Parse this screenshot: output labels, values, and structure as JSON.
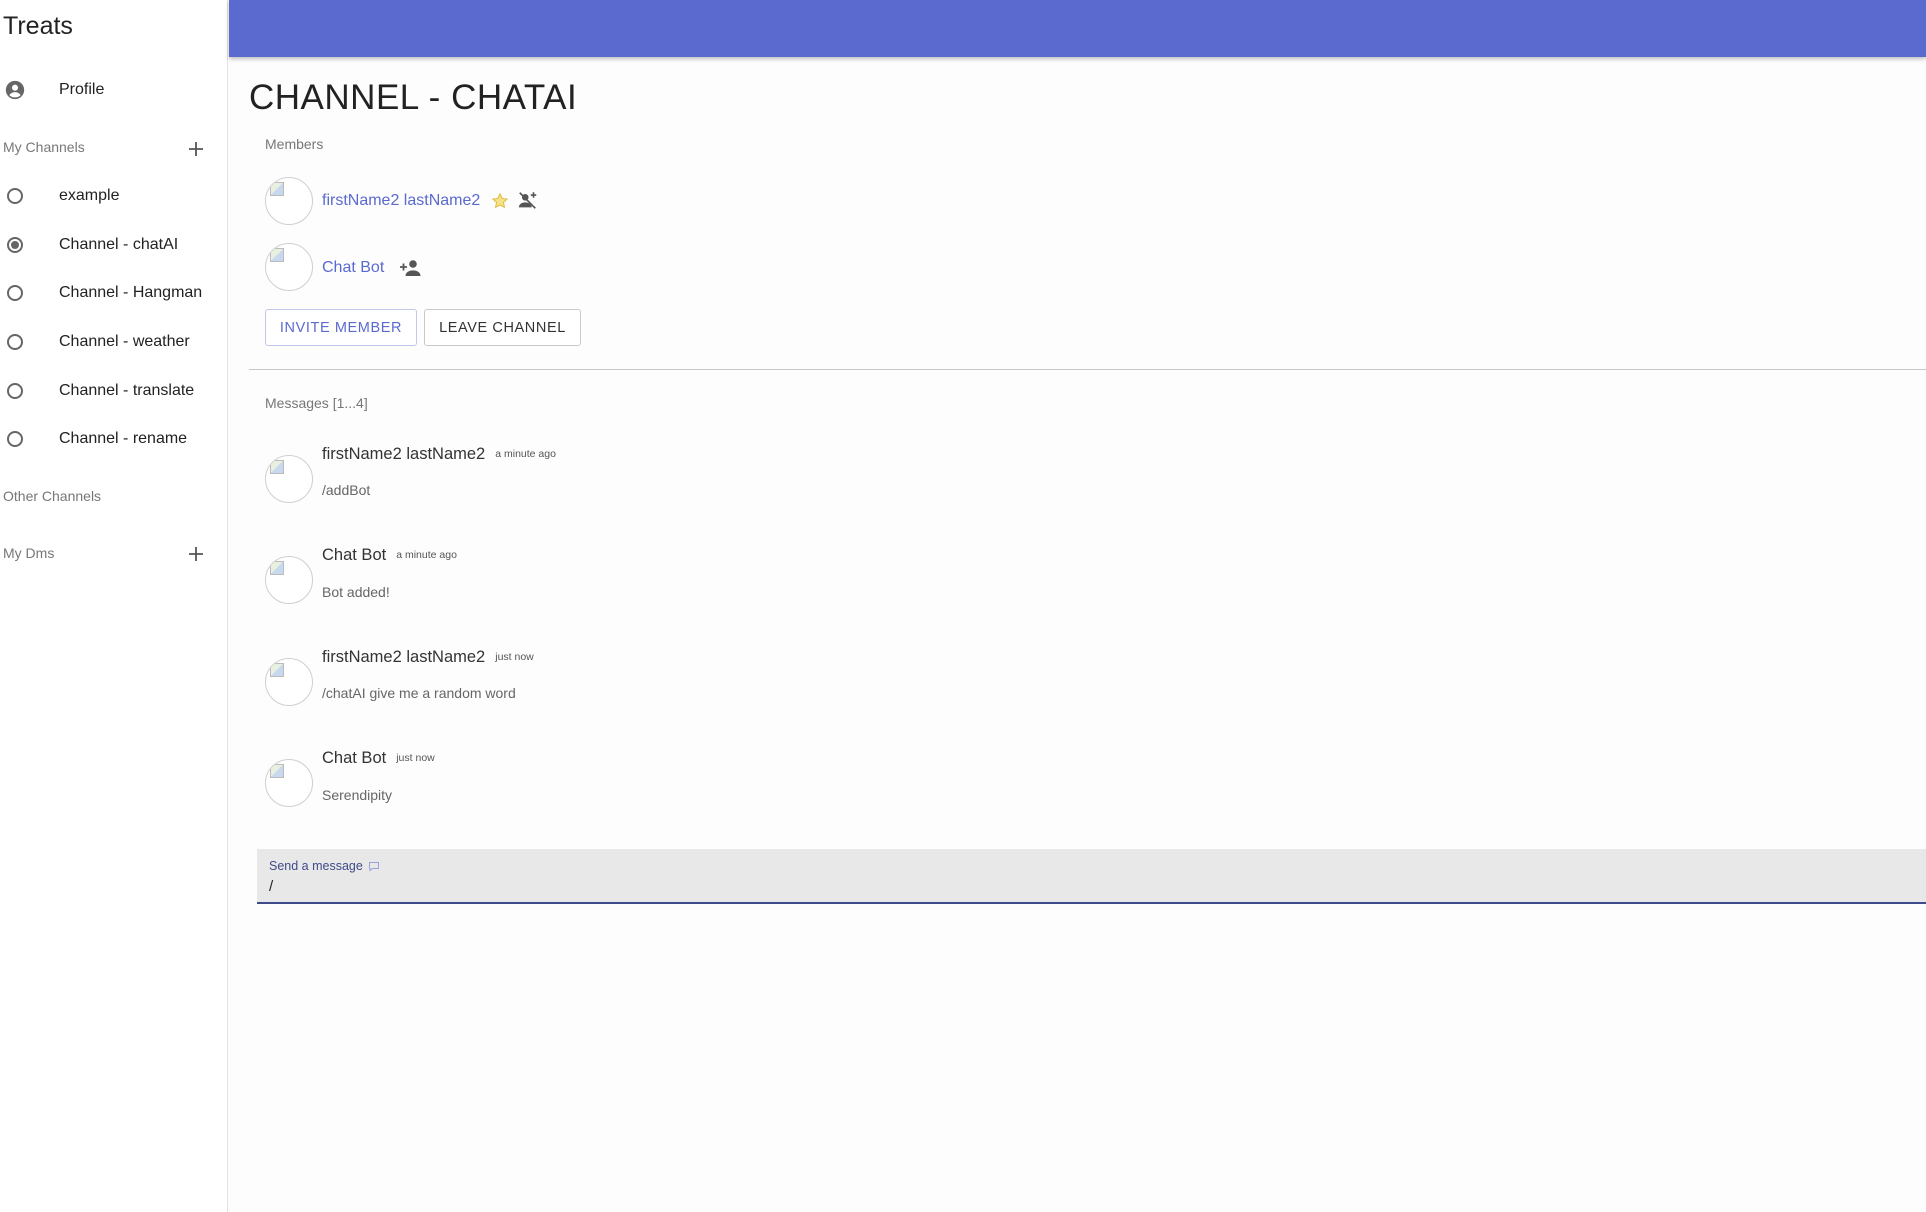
{
  "app": {
    "title": "Treats"
  },
  "sidebar": {
    "profile_label": "Profile",
    "my_channels_label": "My Channels",
    "channels": [
      {
        "label": "example",
        "selected": false
      },
      {
        "label": "Channel - chatAI",
        "selected": true
      },
      {
        "label": "Channel - Hangman",
        "selected": false
      },
      {
        "label": "Channel - weather",
        "selected": false
      },
      {
        "label": "Channel - translate",
        "selected": false
      },
      {
        "label": "Channel - rename",
        "selected": false
      }
    ],
    "other_channels_label": "Other Channels",
    "my_dms_label": "My Dms"
  },
  "header": {
    "color": "#5a6acf"
  },
  "main": {
    "title": "CHANNEL - CHATAI",
    "members_label": "Members",
    "members": [
      {
        "name": "firstName2 lastName2",
        "owner": true,
        "action_icon": "remove-owner-icon"
      },
      {
        "name": "Chat Bot",
        "owner": false,
        "action_icon": "add-owner-icon"
      }
    ],
    "invite_label": "INVITE MEMBER",
    "leave_label": "LEAVE CHANNEL",
    "messages_label": "Messages [1...4]",
    "messages": [
      {
        "sender": "firstName2 lastName2",
        "time": "a minute ago",
        "text": "/addBot"
      },
      {
        "sender": "Chat Bot",
        "time": "a minute ago",
        "text": "Bot added!"
      },
      {
        "sender": "firstName2 lastName2",
        "time": "just now",
        "text": "/chatAI give me a random word"
      },
      {
        "sender": "Chat Bot",
        "time": "just now",
        "text": "Serendipity"
      }
    ],
    "composer": {
      "label": "Send a message",
      "value": "/"
    }
  },
  "colors": {
    "accent": "#5a6acf",
    "composer_underline": "#3f4a8a",
    "owner_star": "#f2c94c"
  }
}
